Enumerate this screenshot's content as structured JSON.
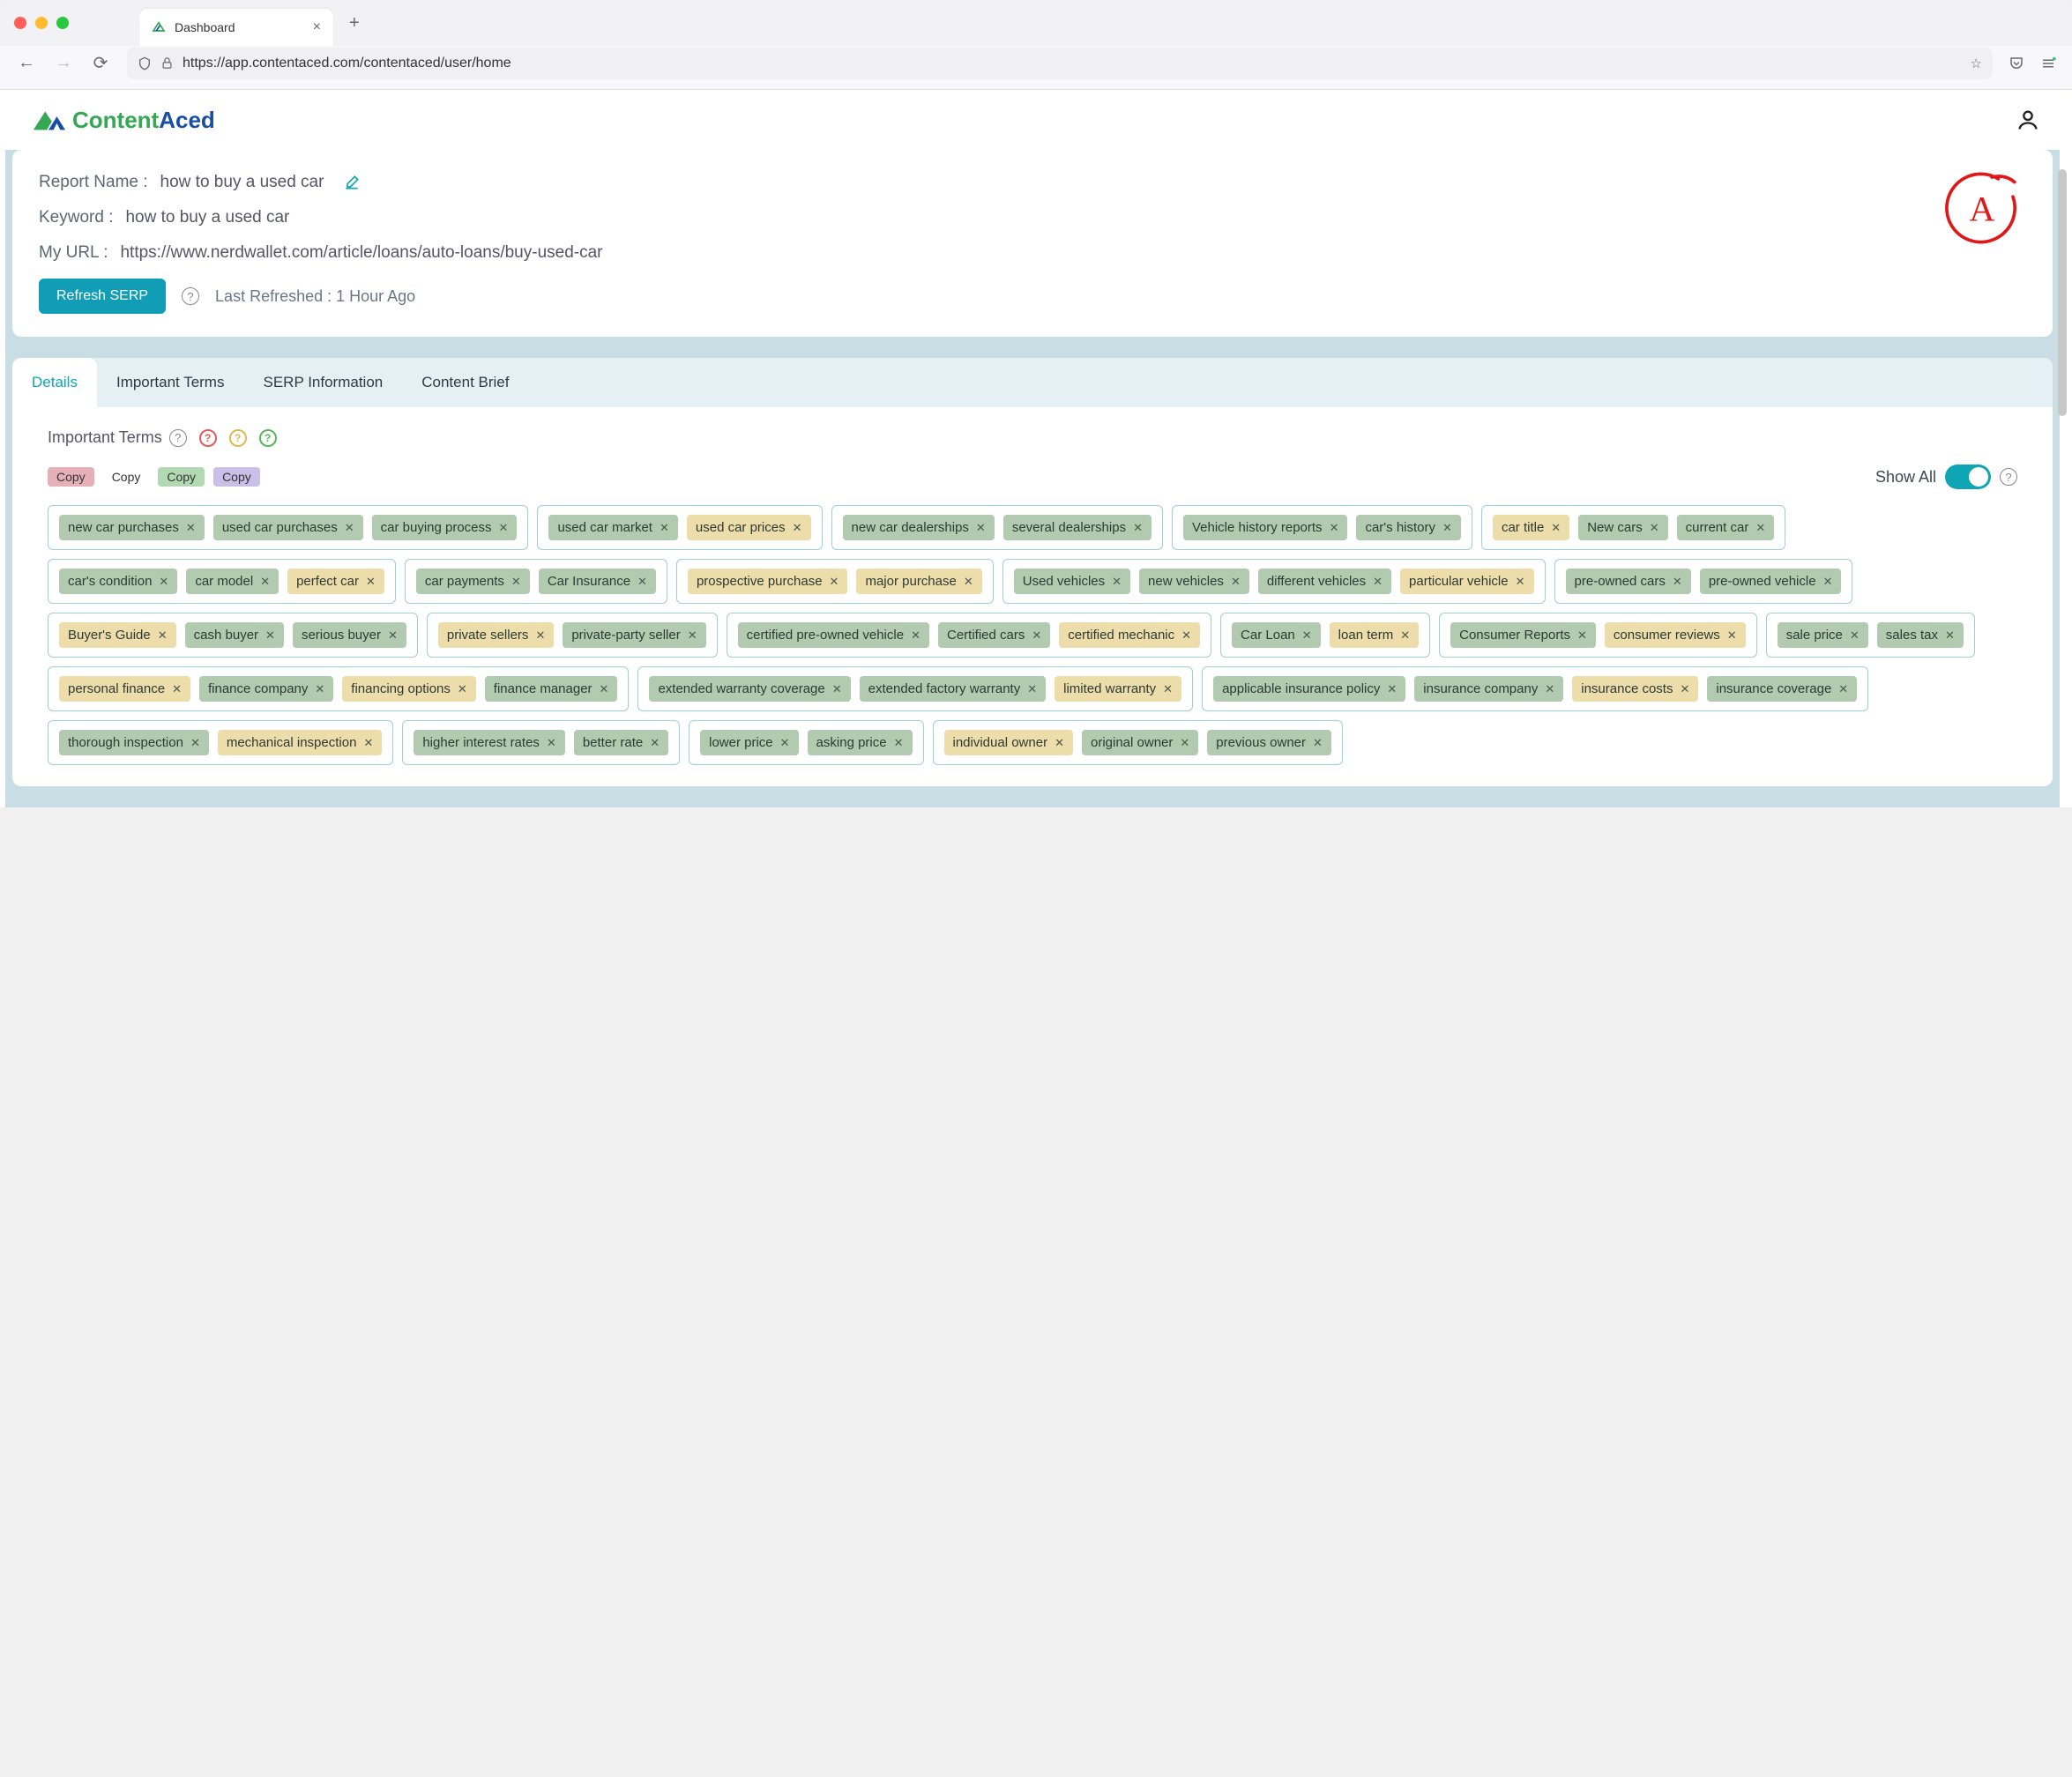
{
  "browser": {
    "tab_title": "Dashboard",
    "url": "https://app.contentaced.com/contentaced/user/home"
  },
  "logo": {
    "part1": "Content",
    "part2": "Aced"
  },
  "report": {
    "name_label": "Report Name :",
    "name_value": "how to buy a used car",
    "keyword_label": "Keyword :",
    "keyword_value": "how to buy a used car",
    "url_label": "My URL :",
    "url_value": "https://www.nerdwallet.com/article/loans/auto-loans/buy-used-car",
    "refresh_btn": "Refresh SERP",
    "last_refreshed": "Last Refreshed : 1 Hour Ago",
    "grade": "A"
  },
  "tabs": {
    "details": "Details",
    "important_terms": "Important Terms",
    "serp_info": "SERP Information",
    "content_brief": "Content Brief"
  },
  "terms": {
    "section_title": "Important Terms",
    "copy": "Copy",
    "show_all": "Show All"
  },
  "term_groups": [
    [
      {
        "t": "new car purchases",
        "c": "g"
      },
      {
        "t": "used car purchases",
        "c": "g"
      },
      {
        "t": "car buying process",
        "c": "g"
      }
    ],
    [
      {
        "t": "used car market",
        "c": "g"
      },
      {
        "t": "used car prices",
        "c": "y"
      }
    ],
    [
      {
        "t": "new car dealerships",
        "c": "g"
      },
      {
        "t": "several dealerships",
        "c": "g"
      }
    ],
    [
      {
        "t": "Vehicle history reports",
        "c": "g"
      },
      {
        "t": "car's history",
        "c": "g"
      }
    ],
    [
      {
        "t": "car title",
        "c": "y"
      },
      {
        "t": "New cars",
        "c": "g"
      },
      {
        "t": "current car",
        "c": "g"
      }
    ],
    [
      {
        "t": "car's condition",
        "c": "g"
      },
      {
        "t": "car model",
        "c": "g"
      },
      {
        "t": "perfect car",
        "c": "y"
      }
    ],
    [
      {
        "t": "car payments",
        "c": "g"
      },
      {
        "t": "Car Insurance",
        "c": "g"
      }
    ],
    [
      {
        "t": "prospective purchase",
        "c": "y"
      },
      {
        "t": "major purchase",
        "c": "y"
      }
    ],
    [
      {
        "t": "Used vehicles",
        "c": "g"
      },
      {
        "t": "new vehicles",
        "c": "g"
      },
      {
        "t": "different vehicles",
        "c": "g"
      },
      {
        "t": "particular vehicle",
        "c": "y"
      }
    ],
    [
      {
        "t": "pre-owned cars",
        "c": "g"
      },
      {
        "t": "pre-owned vehicle",
        "c": "g"
      }
    ],
    [
      {
        "t": "Buyer's Guide",
        "c": "y"
      },
      {
        "t": "cash buyer",
        "c": "g"
      },
      {
        "t": "serious buyer",
        "c": "g"
      }
    ],
    [
      {
        "t": "private sellers",
        "c": "y"
      },
      {
        "t": "private-party seller",
        "c": "g"
      }
    ],
    [
      {
        "t": "certified pre-owned vehicle",
        "c": "g"
      },
      {
        "t": "Certified cars",
        "c": "g"
      },
      {
        "t": "certified mechanic",
        "c": "y"
      }
    ],
    [
      {
        "t": "Car Loan",
        "c": "g"
      },
      {
        "t": "loan term",
        "c": "y"
      }
    ],
    [
      {
        "t": "Consumer Reports",
        "c": "g"
      },
      {
        "t": "consumer reviews",
        "c": "y"
      }
    ],
    [
      {
        "t": "sale price",
        "c": "g"
      },
      {
        "t": "sales tax",
        "c": "g"
      }
    ],
    [
      {
        "t": "personal finance",
        "c": "y"
      },
      {
        "t": "finance company",
        "c": "g"
      },
      {
        "t": "financing options",
        "c": "y"
      },
      {
        "t": "finance manager",
        "c": "g"
      }
    ],
    [
      {
        "t": "extended warranty coverage",
        "c": "g"
      },
      {
        "t": "extended factory warranty",
        "c": "g"
      },
      {
        "t": "limited warranty",
        "c": "y"
      }
    ],
    [
      {
        "t": "applicable insurance policy",
        "c": "g"
      },
      {
        "t": "insurance company",
        "c": "g"
      },
      {
        "t": "insurance costs",
        "c": "y"
      },
      {
        "t": "insurance coverage",
        "c": "g"
      }
    ],
    [
      {
        "t": "thorough inspection",
        "c": "g"
      },
      {
        "t": "mechanical inspection",
        "c": "y"
      }
    ],
    [
      {
        "t": "higher interest rates",
        "c": "g"
      },
      {
        "t": "better rate",
        "c": "g"
      }
    ],
    [
      {
        "t": "lower price",
        "c": "g"
      },
      {
        "t": "asking price",
        "c": "g"
      }
    ],
    [
      {
        "t": "individual owner",
        "c": "y"
      },
      {
        "t": "original owner",
        "c": "g"
      },
      {
        "t": "previous owner",
        "c": "g"
      }
    ]
  ]
}
